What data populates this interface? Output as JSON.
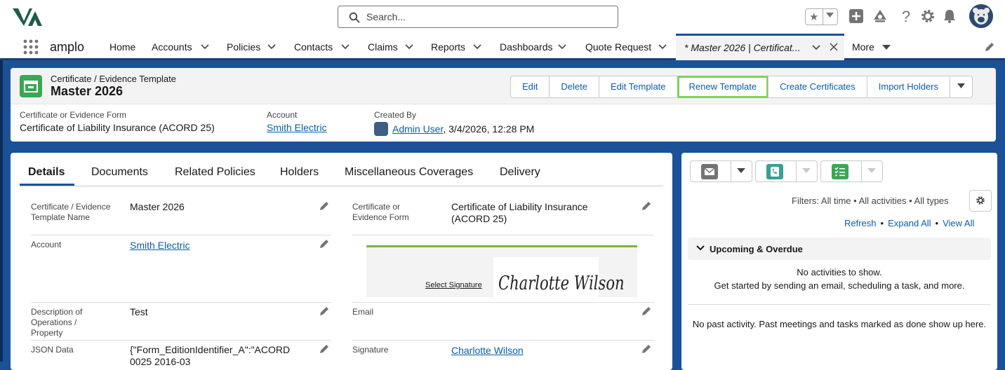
{
  "header": {
    "search_placeholder": "Search..."
  },
  "nav": {
    "app_name": "amplo",
    "items": [
      {
        "label": "Home",
        "has_menu": false
      },
      {
        "label": "Accounts",
        "has_menu": true
      },
      {
        "label": "Policies",
        "has_menu": true
      },
      {
        "label": "Contacts",
        "has_menu": true
      },
      {
        "label": "Claims",
        "has_menu": true
      },
      {
        "label": "Reports",
        "has_menu": true
      },
      {
        "label": "Dashboards",
        "has_menu": true
      },
      {
        "label": "Quote Request",
        "has_menu": true
      }
    ],
    "active_tab": "* Master 2026 | Certificat...",
    "more_label": "More"
  },
  "record": {
    "object_type": "Certificate / Evidence Template",
    "title": "Master 2026",
    "buttons": [
      "Edit",
      "Delete",
      "Edit Template",
      "Renew Template",
      "Create Certificates",
      "Import Holders"
    ],
    "highlighted_button": "Renew Template",
    "highlights": {
      "form_label": "Certificate or Evidence Form",
      "form_value": "Certificate of Liability Insurance (ACORD 25)",
      "account_label": "Account",
      "account_value": "Smith Electric",
      "created_label": "Created By",
      "created_user": "Admin User",
      "created_date": ", 3/4/2026, 12:28 PM"
    }
  },
  "tabs": [
    "Details",
    "Documents",
    "Related Policies",
    "Holders",
    "Miscellaneous Coverages",
    "Delivery"
  ],
  "active_detail_tab": "Details",
  "details": {
    "name_label": "Certificate / Evidence Template Name",
    "name_value": "Master 2026",
    "form_label": "Certificate or Evidence Form",
    "form_value": "Certificate of Liability Insurance (ACORD 25)",
    "account_label": "Account",
    "account_value": "Smith Electric",
    "signature_link": "Select Signature",
    "signature_image_text": "Charlotte Wilson",
    "description_label": "Description of Operations / Property",
    "description_value": "Test",
    "email_label": "Email",
    "email_value": "",
    "json_label": "JSON Data",
    "json_value": "{\"Form_EditionIdentifier_A\":\"ACORD 0025 2016-03",
    "signature_label": "Signature",
    "signature_value": "Charlotte Wilson"
  },
  "activity": {
    "filters": "Filters: All time • All activities • All types",
    "links": [
      "Refresh",
      "Expand All",
      "View All"
    ],
    "section_title": "Upcoming & Overdue",
    "no_activities": "No activities to show.",
    "get_started": "Get started by sending an email, scheduling a task, and more.",
    "no_past": "No past activity. Past meetings and tasks marked as done show up here."
  },
  "colors": {
    "brand_blue": "#1b5297",
    "link_blue": "#0b5cab",
    "highlight_outline": "#7ed35a",
    "object_icon_green": "#3ba755",
    "call_icon_teal": "#3a9f95",
    "task_icon_green": "#3ba755",
    "email_icon_gray": "#747474"
  }
}
